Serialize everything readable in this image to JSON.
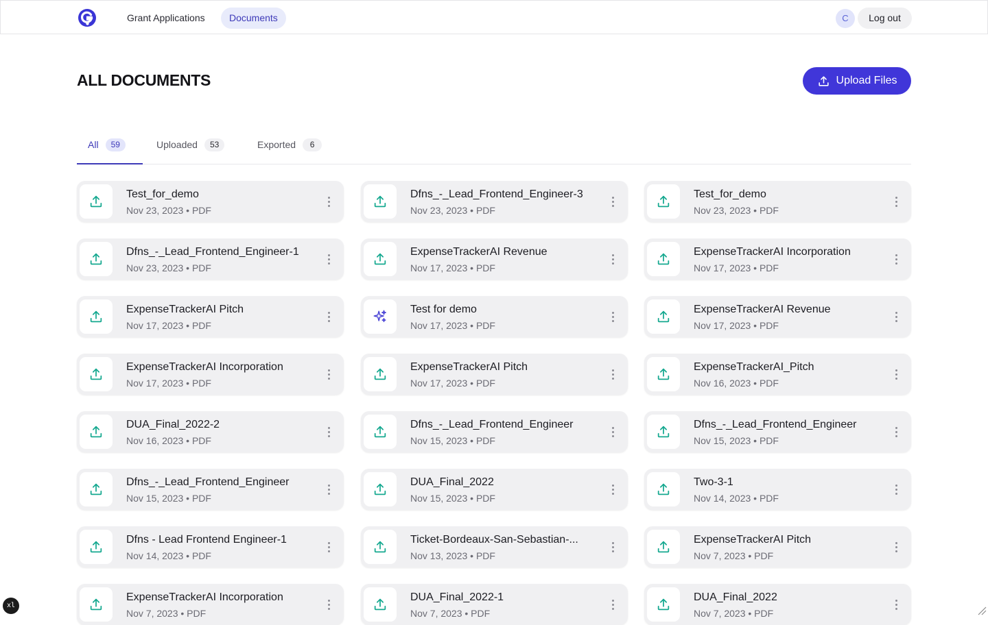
{
  "nav": {
    "items": [
      {
        "label": "Grant Applications",
        "active": false
      },
      {
        "label": "Documents",
        "active": true
      }
    ],
    "avatar_initial": "C",
    "logout_label": "Log out"
  },
  "page": {
    "title": "ALL DOCUMENTS",
    "upload_label": "Upload Files"
  },
  "tabs": [
    {
      "label": "All",
      "count": "59",
      "active": true
    },
    {
      "label": "Uploaded",
      "count": "53",
      "active": false
    },
    {
      "label": "Exported",
      "count": "6",
      "active": false
    }
  ],
  "documents": [
    {
      "name": "Test_for_demo",
      "meta": "Nov 23, 2023 • PDF",
      "icon": "upload-icon"
    },
    {
      "name": "Dfns_-_Lead_Frontend_Engineer-3",
      "meta": "Nov 23, 2023 • PDF",
      "icon": "upload-icon"
    },
    {
      "name": "Test_for_demo",
      "meta": "Nov 23, 2023 • PDF",
      "icon": "upload-icon"
    },
    {
      "name": "Dfns_-_Lead_Frontend_Engineer-1",
      "meta": "Nov 23, 2023 • PDF",
      "icon": "upload-icon"
    },
    {
      "name": "ExpenseTrackerAI Revenue",
      "meta": "Nov 17, 2023 • PDF",
      "icon": "upload-icon"
    },
    {
      "name": "ExpenseTrackerAI Incorporation",
      "meta": "Nov 17, 2023 • PDF",
      "icon": "upload-icon"
    },
    {
      "name": "ExpenseTrackerAI Pitch",
      "meta": "Nov 17, 2023 • PDF",
      "icon": "upload-icon"
    },
    {
      "name": "Test for demo",
      "meta": "Nov 17, 2023 • PDF",
      "icon": "sparkle-icon"
    },
    {
      "name": "ExpenseTrackerAI Revenue",
      "meta": "Nov 17, 2023 • PDF",
      "icon": "upload-icon"
    },
    {
      "name": "ExpenseTrackerAI Incorporation",
      "meta": "Nov 17, 2023 • PDF",
      "icon": "upload-icon"
    },
    {
      "name": "ExpenseTrackerAI Pitch",
      "meta": "Nov 17, 2023 • PDF",
      "icon": "upload-icon"
    },
    {
      "name": "ExpenseTrackerAI_Pitch",
      "meta": "Nov 16, 2023 • PDF",
      "icon": "upload-icon"
    },
    {
      "name": "DUA_Final_2022-2",
      "meta": "Nov 16, 2023 • PDF",
      "icon": "upload-icon"
    },
    {
      "name": "Dfns_-_Lead_Frontend_Engineer",
      "meta": "Nov 15, 2023 • PDF",
      "icon": "upload-icon"
    },
    {
      "name": "Dfns_-_Lead_Frontend_Engineer",
      "meta": "Nov 15, 2023 • PDF",
      "icon": "upload-icon"
    },
    {
      "name": "Dfns_-_Lead_Frontend_Engineer",
      "meta": "Nov 15, 2023 • PDF",
      "icon": "upload-icon"
    },
    {
      "name": "DUA_Final_2022",
      "meta": "Nov 15, 2023 • PDF",
      "icon": "upload-icon"
    },
    {
      "name": "Two-3-1",
      "meta": "Nov 14, 2023 • PDF",
      "icon": "upload-icon"
    },
    {
      "name": "Dfns - Lead Frontend Engineer-1",
      "meta": "Nov 14, 2023 • PDF",
      "icon": "upload-icon"
    },
    {
      "name": "Ticket-Bordeaux-San-Sebastian-...",
      "meta": "Nov 13, 2023 • PDF",
      "icon": "upload-icon"
    },
    {
      "name": "ExpenseTrackerAI Pitch",
      "meta": "Nov 7, 2023 • PDF",
      "icon": "upload-icon"
    },
    {
      "name": "ExpenseTrackerAI Incorporation",
      "meta": "Nov 7, 2023 • PDF",
      "icon": "upload-icon"
    },
    {
      "name": "DUA_Final_2022-1",
      "meta": "Nov 7, 2023 • PDF",
      "icon": "upload-icon"
    },
    {
      "name": "DUA_Final_2022",
      "meta": "Nov 7, 2023 • PDF",
      "icon": "upload-icon"
    }
  ],
  "overlay": {
    "badge": "xl"
  },
  "colors": {
    "accent": "#4036d9",
    "accent_text": "#3e3ab8",
    "upload_icon": "#14a88f",
    "sparkle_icon": "#4a44d6",
    "card_bg": "#f0f0f2"
  }
}
